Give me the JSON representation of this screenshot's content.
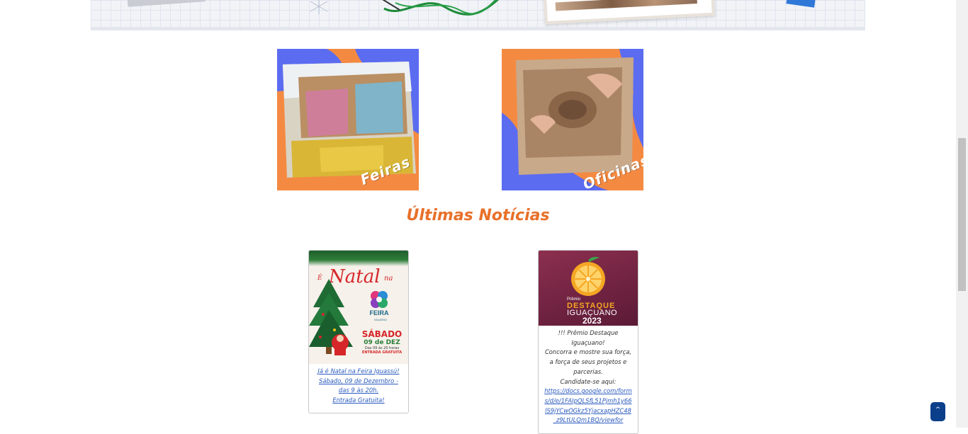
{
  "categories": [
    {
      "label": "Feiras"
    },
    {
      "label": "Oficinas"
    }
  ],
  "news_section": {
    "title": "Últimas Notícias"
  },
  "news": [
    {
      "poster": {
        "e": "É",
        "natal": "Natal",
        "na": "na",
        "feira": "FEIRA",
        "iguassu": "IGUASSU",
        "sabado": "SÁBADO",
        "date": "09 de DEZ",
        "hours": "Das 09 às 20 horas",
        "entrada": "ENTRADA GRATUITA"
      },
      "lines": [
        "Já é Natal na Feira Iguassú!",
        "Sábado, 09 de Dezembro -",
        "das 9 às 20h.",
        "Entrada Gratuita!"
      ]
    },
    {
      "poster": {
        "premio": "Prêmio",
        "destaque": "DESTAQUE",
        "iguacuano": "IGUAÇUANO",
        "year": "2023"
      },
      "lines": [
        "!!! Prêmio Destaque Iguaçuano!",
        "Concorra e mostre sua força,",
        "a força de seus projetos e parcerias.",
        "Candidate-se aqui:"
      ],
      "link": "https://docs.google.com/forms/d/e/1FAIpQLSfL51Pjmh1y66lS9jYCwOGkz5YjacxapHZC48_z9LtULQm1BQ/viewfor"
    }
  ],
  "back_to_top": {
    "label": "^"
  },
  "colors": {
    "accent_orange": "#e8712a",
    "link_blue": "#2a5bbf",
    "button_navy": "#0b3f8a"
  }
}
